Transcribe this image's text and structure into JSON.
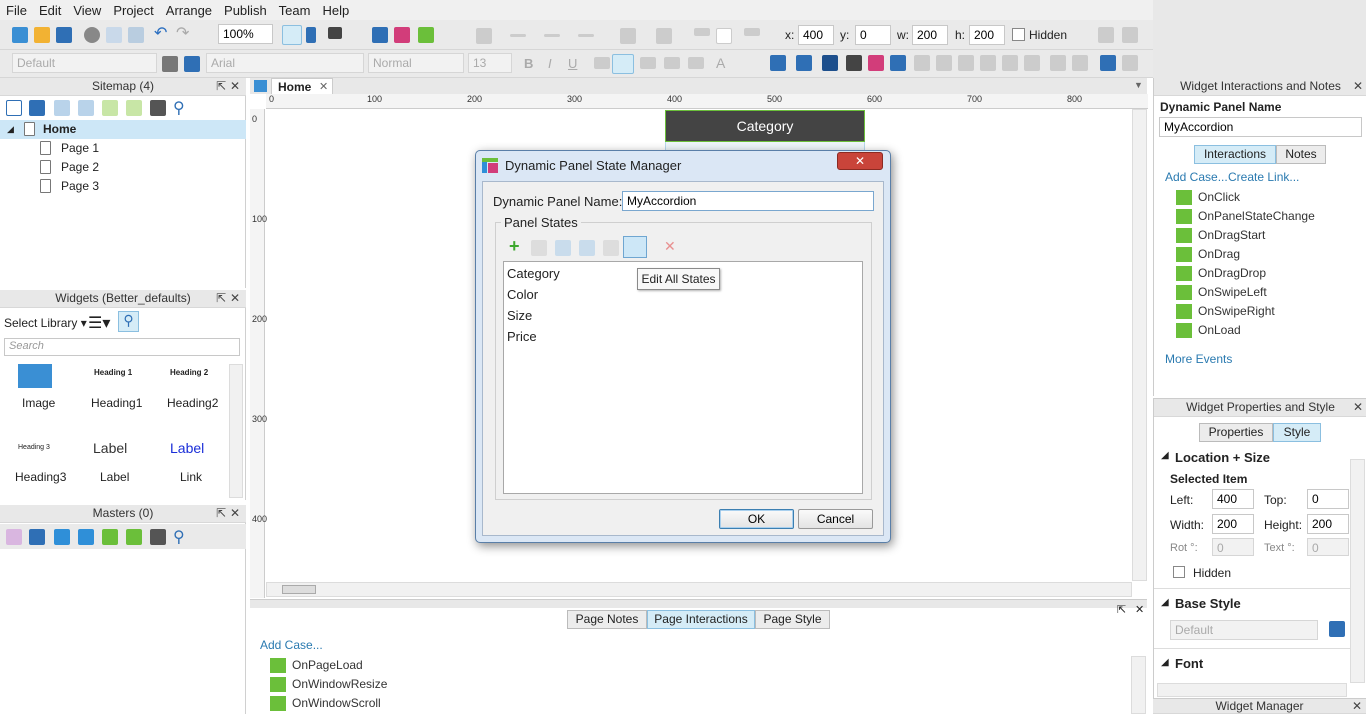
{
  "menu": [
    "File",
    "Edit",
    "View",
    "Project",
    "Arrange",
    "Publish",
    "Team",
    "Help"
  ],
  "toolbar": {
    "zoom": "100%",
    "x_label": "x:",
    "x": "400",
    "y_label": "y:",
    "y": "0",
    "w_label": "w:",
    "w": "200",
    "h_label": "h:",
    "h": "200",
    "hidden_label": "Hidden",
    "style_default": "Default",
    "font": "Arial",
    "weight": "Normal",
    "size": "13"
  },
  "sitemap": {
    "title": "Sitemap (4)",
    "home": "Home",
    "pages": [
      "Page 1",
      "Page 2",
      "Page 3"
    ]
  },
  "widgets": {
    "title": "Widgets (Better_defaults)",
    "select_library": "Select Library",
    "search_placeholder": "Search",
    "items": [
      {
        "preview": "",
        "label": "Image"
      },
      {
        "preview": "Heading 1",
        "label": "Heading1"
      },
      {
        "preview": "Heading 2",
        "label": "Heading2"
      },
      {
        "preview": "Heading 3",
        "label": "Heading3"
      },
      {
        "preview": "Label",
        "label": "Label"
      },
      {
        "preview": "Label",
        "label": "Link"
      }
    ]
  },
  "masters": {
    "title": "Masters (0)"
  },
  "canvas": {
    "tab": "Home",
    "category_label": "Category",
    "ruler_h": [
      "0",
      "100",
      "200",
      "300",
      "400",
      "500",
      "600",
      "700",
      "800"
    ],
    "ruler_v": [
      "0",
      "100",
      "200",
      "300",
      "400"
    ]
  },
  "dialog": {
    "title": "Dynamic Panel State Manager",
    "name_label": "Dynamic Panel Name:",
    "name_value": "MyAccordion",
    "states_label": "Panel States",
    "states": [
      "Category",
      "Color",
      "Size",
      "Price"
    ],
    "tooltip": "Edit All States",
    "ok": "OK",
    "cancel": "Cancel"
  },
  "bottom": {
    "tabs": [
      "Page Notes",
      "Page Interactions",
      "Page Style"
    ],
    "add_case": "Add Case...",
    "events": [
      "OnPageLoad",
      "OnWindowResize",
      "OnWindowScroll"
    ]
  },
  "interactions": {
    "title": "Widget Interactions and Notes",
    "name_label": "Dynamic Panel Name",
    "name_value": "MyAccordion",
    "tabs": [
      "Interactions",
      "Notes"
    ],
    "add_case": "Add Case...",
    "create_link": "Create Link...",
    "events": [
      "OnClick",
      "OnPanelStateChange",
      "OnDragStart",
      "OnDrag",
      "OnDragDrop",
      "OnSwipeLeft",
      "OnSwipeRight",
      "OnLoad"
    ],
    "more_events": "More Events"
  },
  "properties": {
    "title": "Widget Properties and Style",
    "tabs": [
      "Properties",
      "Style"
    ],
    "location_size": "Location + Size",
    "selected_item": "Selected Item",
    "left_label": "Left:",
    "left": "400",
    "top_label": "Top:",
    "top": "0",
    "width_label": "Width:",
    "width": "200",
    "height_label": "Height:",
    "height": "200",
    "rot_label": "Rot °:",
    "rot": "0",
    "text_label": "Text °:",
    "text": "0",
    "hidden_label": "Hidden",
    "base_style": "Base Style",
    "base_style_value": "Default",
    "font": "Font"
  },
  "widget_manager": "Widget Manager"
}
